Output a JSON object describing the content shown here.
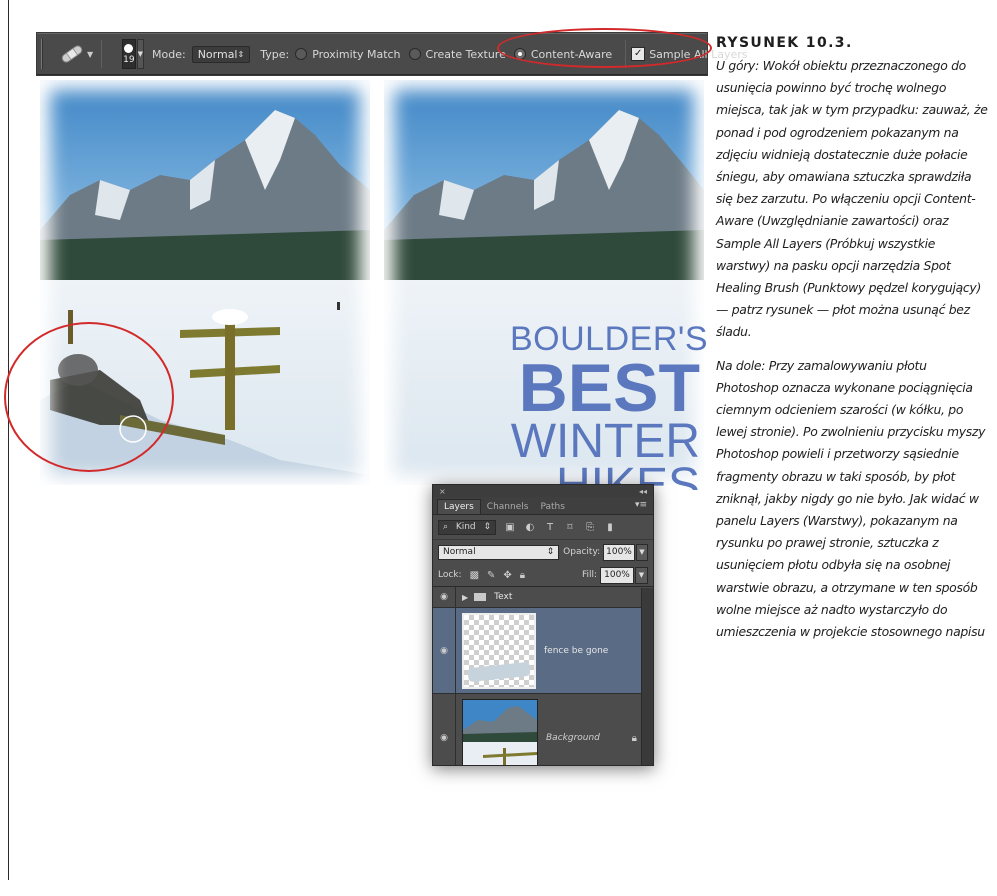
{
  "toolbar": {
    "brush_size": "19",
    "mode_label": "Mode:",
    "mode_value": "Normal",
    "type_label": "Type:",
    "proximity_label": "Proximity Match",
    "create_texture_label": "Create Texture",
    "content_aware_label": "Content-Aware",
    "sample_all_label": "Sample All Layers"
  },
  "headline": {
    "line1": "BOULDER'S",
    "line2": "BEST",
    "line3": "WINTER",
    "line4": "HIKES"
  },
  "layers_panel": {
    "tabs": [
      "Layers",
      "Channels",
      "Paths"
    ],
    "kind_label": "Kind",
    "blend_mode": "Normal",
    "opacity_label": "Opacity:",
    "opacity_value": "100%",
    "lock_label": "Lock:",
    "fill_label": "Fill:",
    "fill_value": "100%",
    "layers": [
      {
        "name": "Text"
      },
      {
        "name": "fence be gone"
      },
      {
        "name": "Background"
      }
    ]
  },
  "caption": {
    "title": "RYSUNEK 10.3.",
    "para1": "U góry: Wokół obiektu przeznaczonego do usunięcia powinno być trochę wolnego miejsca, tak jak w tym przypadku: zauważ, że ponad i pod ogrodzeniem pokazanym na zdjęciu widnieją dostatecznie duże połacie śniegu, aby omawiana sztuczka sprawdziła się bez zarzutu. Po włączeniu opcji Content-Aware (Uwzględnianie zawartości) oraz Sample All Layers (Próbkuj wszystkie warstwy) na pasku opcji narzędzia Spot Healing Brush (Punktowy pędzel korygujący) — patrz rysunek — płot można usunąć bez śladu.",
    "para2": "Na dole: Przy zamalowywaniu płotu Photoshop oznacza wykonane pociągnięcia ciemnym odcieniem szarości (w kółku, po lewej stronie). Po zwolnieniu przycisku myszy Photoshop powieli i przetworzy sąsiednie fragmenty obrazu w taki sposób, by płot zniknął, jakby nigdy go nie było. Jak widać w panelu Layers (Warstwy), pokazanym na rysunku po prawej stronie, sztuczka z usunięciem płotu odbyła się na osobnej warstwie obrazu, a otrzymane w ten sposób wolne miejsce aż nadto wystarczyło do umieszczenia w projekcie stosownego napisu"
  }
}
